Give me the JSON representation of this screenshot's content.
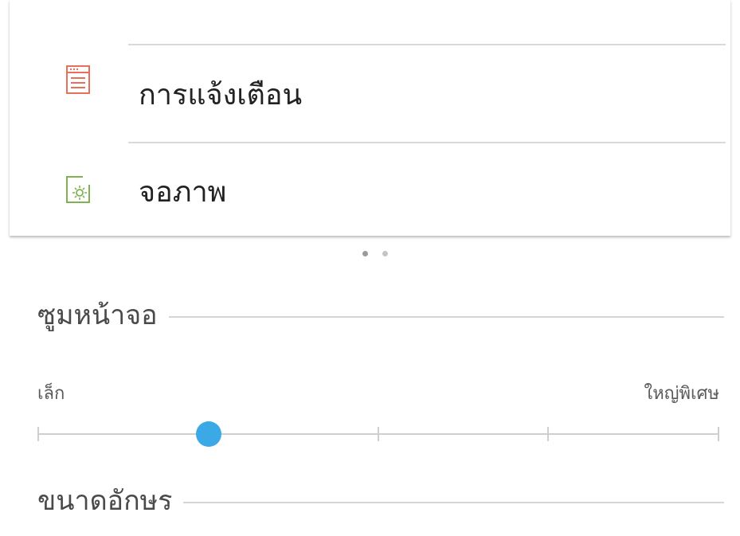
{
  "preview": {
    "items": [
      {
        "label": "การแจ้งเตือน",
        "icon": "notifications-icon",
        "icon_color": "#e8705b"
      },
      {
        "label": "จอภาพ",
        "icon": "display-icon",
        "icon_color": "#7fb352"
      }
    ]
  },
  "pager": {
    "pages": 2,
    "current": 1
  },
  "screen_zoom": {
    "title": "ซูมหน้าจอ",
    "min_label": "เล็ก",
    "max_label": "ใหญ่พิเศษ",
    "steps": 5,
    "value_index": 1,
    "thumb_color": "#3aa9e6"
  },
  "font_size": {
    "title": "ขนาดอักษร"
  }
}
